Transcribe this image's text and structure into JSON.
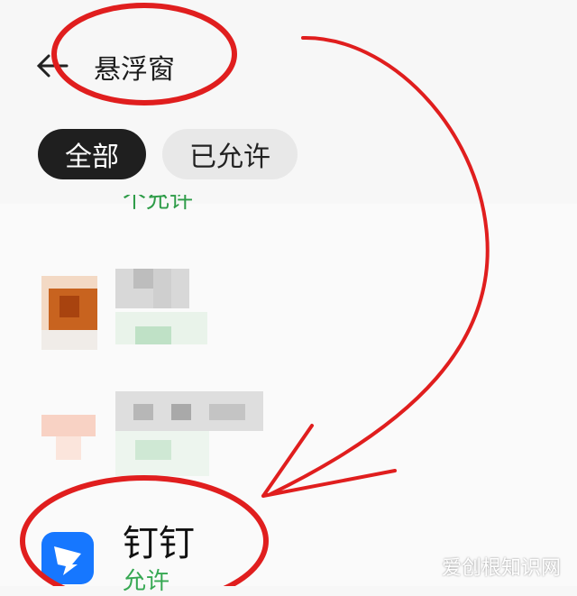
{
  "header": {
    "title": "悬浮窗",
    "back_icon": "arrow-left-icon"
  },
  "tabs": [
    {
      "label": "全部",
      "active": true
    },
    {
      "label": "已允许",
      "active": false
    }
  ],
  "list": {
    "cut_status": "个允许",
    "items": [
      {
        "name": "钉钉",
        "status": "允许",
        "icon": "dingtalk-icon"
      }
    ]
  },
  "watermark": "爱创根知识网",
  "colors": {
    "accent_green": "#36a852",
    "annotation_red": "#e01e1e",
    "tab_active": "#1f1f1f",
    "dingtalk_blue": "#1677ff"
  }
}
